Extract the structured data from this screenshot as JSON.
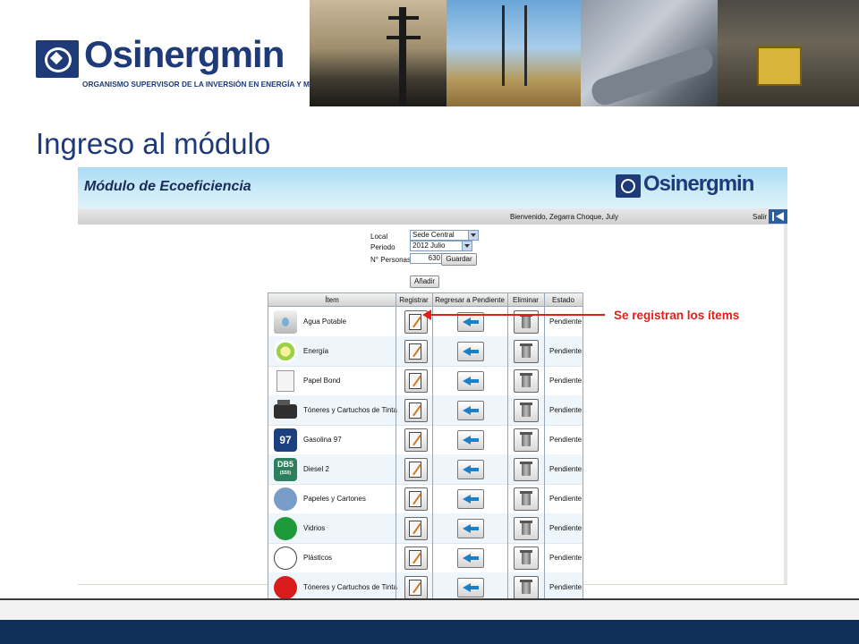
{
  "banner": {
    "logo_text": "Osinergmin",
    "logo_subtitle": "ORGANISMO SUPERVISOR DE LA INVERSIÓN EN ENERGÍA Y MINERÍA"
  },
  "slide": {
    "title": "Ingreso al módulo"
  },
  "app": {
    "title": "Módulo de Ecoeficiencia",
    "logo_text": "Osinergmin",
    "welcome": "Bienvenido,  Zegarra Choque, July",
    "logout_label": "Salir",
    "form": {
      "local_label": "Local",
      "local_value": "Sede Central",
      "periodo_label": "Periodo",
      "periodo_value": "2012 Julio",
      "personas_label": "N° Personas",
      "personas_value": "630",
      "guardar_label": "Guardar",
      "anadir_label": "Añadir"
    },
    "table": {
      "headers": {
        "item": "Ítem",
        "registrar": "Registrar",
        "regresar": "Regresar a Pendiente",
        "eliminar": "Eliminar",
        "estado": "Estado"
      },
      "rows": [
        {
          "name": "Agua Potable",
          "icon": "water-icon",
          "estado": "Pendiente"
        },
        {
          "name": "Energía",
          "icon": "energy-icon",
          "estado": "Pendiente"
        },
        {
          "name": "Papel Bond",
          "icon": "paper-icon",
          "estado": "Pendiente"
        },
        {
          "name": "Tóneres y Cartuchos de Tinta",
          "icon": "toner-icon",
          "estado": "Pendiente"
        },
        {
          "name": "Gasolina 97",
          "icon": "gasoline-icon",
          "badge": "97",
          "estado": "Pendiente"
        },
        {
          "name": "Diesel 2",
          "icon": "diesel-icon",
          "badge": "DB5",
          "badge_sub": "(S50)",
          "estado": "Pendiente"
        },
        {
          "name": "Papeles y Cartones",
          "icon": "blue-circle-icon",
          "color": "#7a9cc9",
          "estado": "Pendiente"
        },
        {
          "name": "Vidrios",
          "icon": "green-circle-icon",
          "color": "#1e9a3a",
          "estado": "Pendiente"
        },
        {
          "name": "Plásticos",
          "icon": "white-circle-icon",
          "color": "#ffffff",
          "estado": "Pendiente"
        },
        {
          "name": "Tóneres y Cartuchos de Tinta",
          "icon": "red-circle-icon",
          "color": "#d81c1c",
          "estado": "Pendiente"
        }
      ]
    }
  },
  "annotation": {
    "text": "Se registran los ítems",
    "color": "#e22019"
  },
  "colors": {
    "brand_blue": "#1f3a78",
    "footer_blue": "#10305a",
    "header_gradient": "#a8dcf5"
  }
}
